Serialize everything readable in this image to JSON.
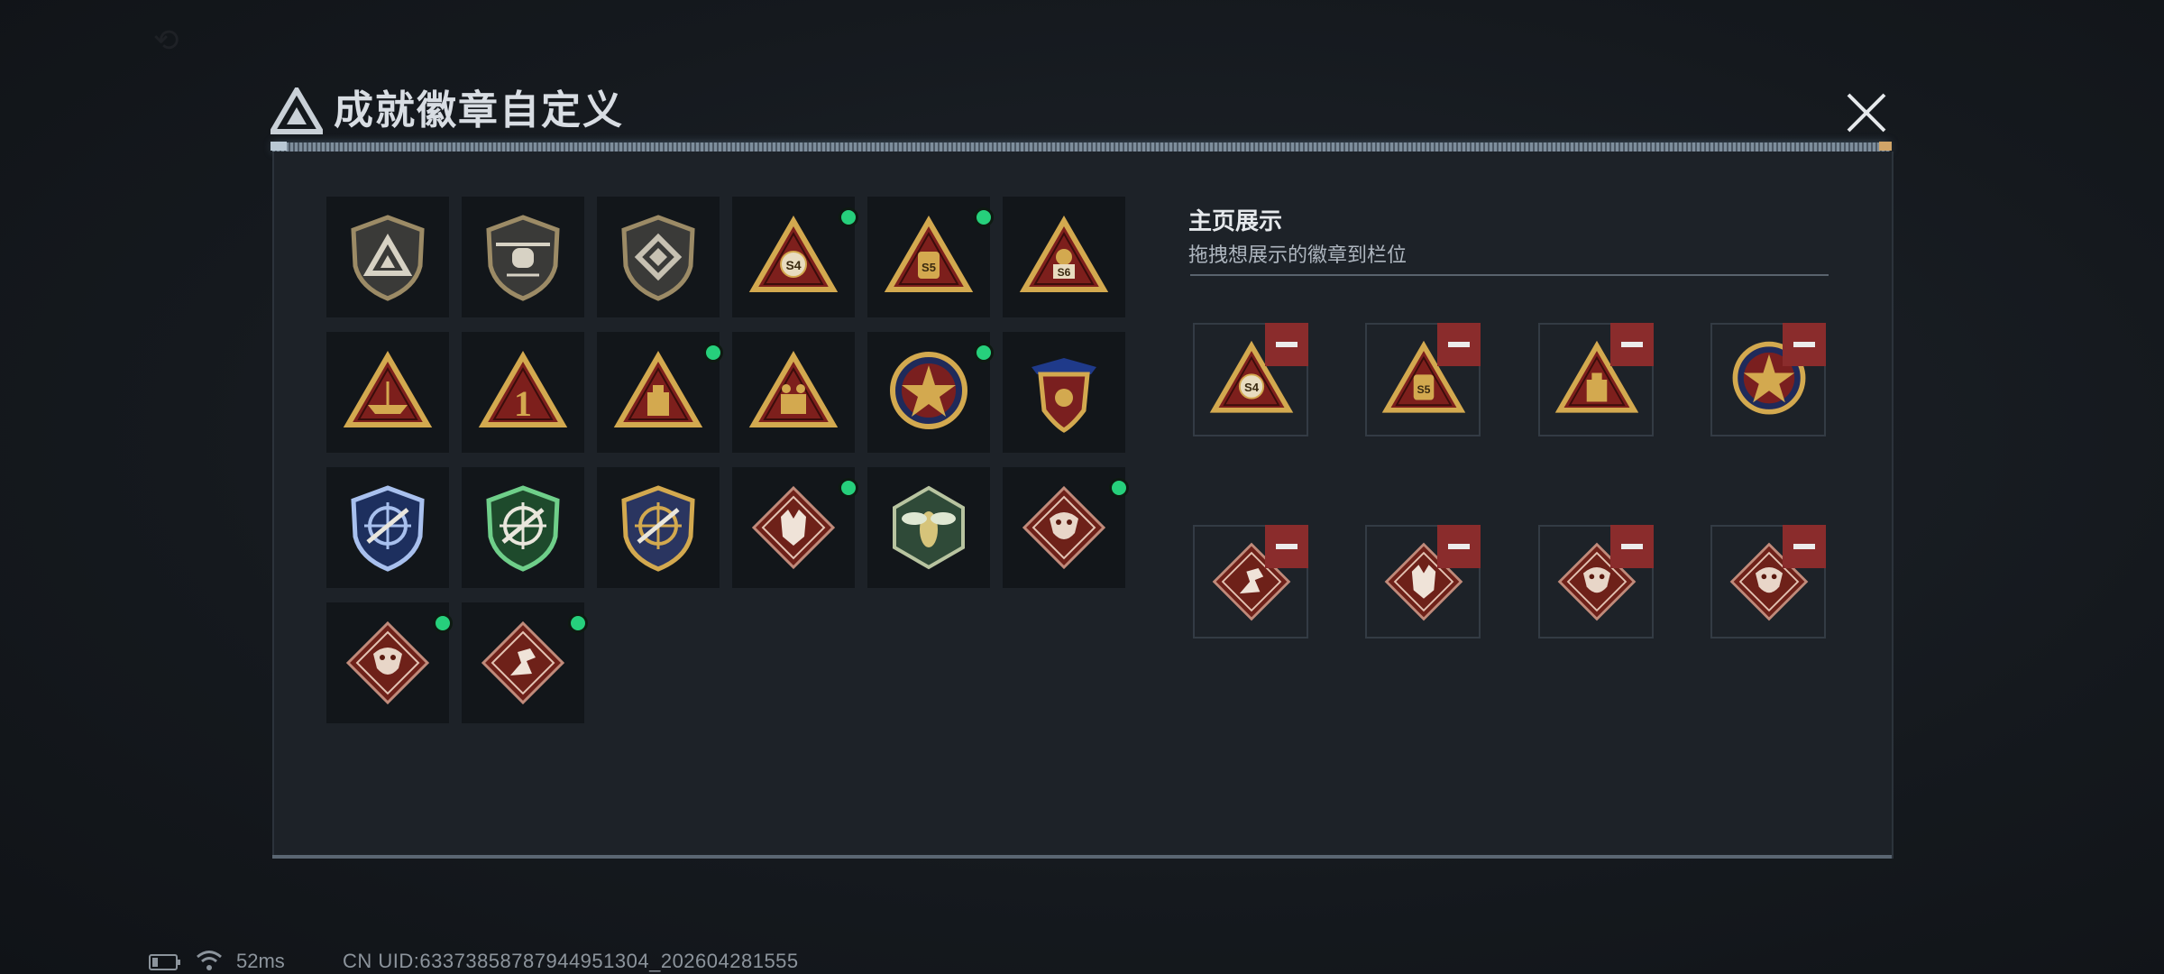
{
  "header": {
    "title": "成就徽章自定义"
  },
  "showcase": {
    "title": "主页展示",
    "subtitle": "拖拽想展示的徽章到栏位",
    "slots": [
      {
        "badge": "s4-triangle-badge-icon"
      },
      {
        "badge": "s5-triangle-badge-icon"
      },
      {
        "badge": "crate-triangle-badge-icon"
      },
      {
        "badge": "star-shield-badge-icon"
      },
      {
        "badge": "runner-diamond-badge-icon"
      },
      {
        "badge": "wolf-diamond-badge-icon"
      },
      {
        "badge": "dragon-diamond-badge-icon"
      },
      {
        "badge": "dragon-diamond-badge-icon"
      }
    ]
  },
  "badges": [
    {
      "icon": "delta-shield-badge-icon",
      "new": false
    },
    {
      "icon": "helicopter-shield-badge-icon",
      "new": false
    },
    {
      "icon": "diamond-emblem-shield-badge-icon",
      "new": false
    },
    {
      "icon": "s4-triangle-badge-icon",
      "new": true
    },
    {
      "icon": "s5-triangle-badge-icon",
      "new": true
    },
    {
      "icon": "s6-triangle-badge-icon",
      "new": false
    },
    {
      "icon": "ship-triangle-badge-icon",
      "new": false
    },
    {
      "icon": "number-one-triangle-badge-icon",
      "new": false
    },
    {
      "icon": "crate-triangle-badge-icon",
      "new": true
    },
    {
      "icon": "soldiers-triangle-badge-icon",
      "new": false
    },
    {
      "icon": "star-shield-badge-icon",
      "new": true
    },
    {
      "icon": "winged-shield-badge-icon",
      "new": false
    },
    {
      "icon": "blue-crosshair-shield-badge-icon",
      "new": false
    },
    {
      "icon": "green-crosshair-shield-badge-icon",
      "new": false
    },
    {
      "icon": "gold-blue-crosshair-shield-badge-icon",
      "new": false
    },
    {
      "icon": "wolf-diamond-badge-icon",
      "new": true
    },
    {
      "icon": "wasp-hexagon-badge-icon",
      "new": false
    },
    {
      "icon": "dragon-diamond-badge-icon",
      "new": true
    },
    {
      "icon": "dragon-diamond-badge-icon",
      "new": true
    },
    {
      "icon": "runner-diamond-badge-icon",
      "new": true
    }
  ],
  "status": {
    "ping": "52ms",
    "uid": "CN UID:633738587879449513​04_202604281555"
  },
  "colors": {
    "gold": "#d3a94f",
    "triangle_red": "#7d1f1c",
    "diamond_red": "#6e2119",
    "new_dot": "#26d07c",
    "remove_red": "#8a2c2c"
  }
}
